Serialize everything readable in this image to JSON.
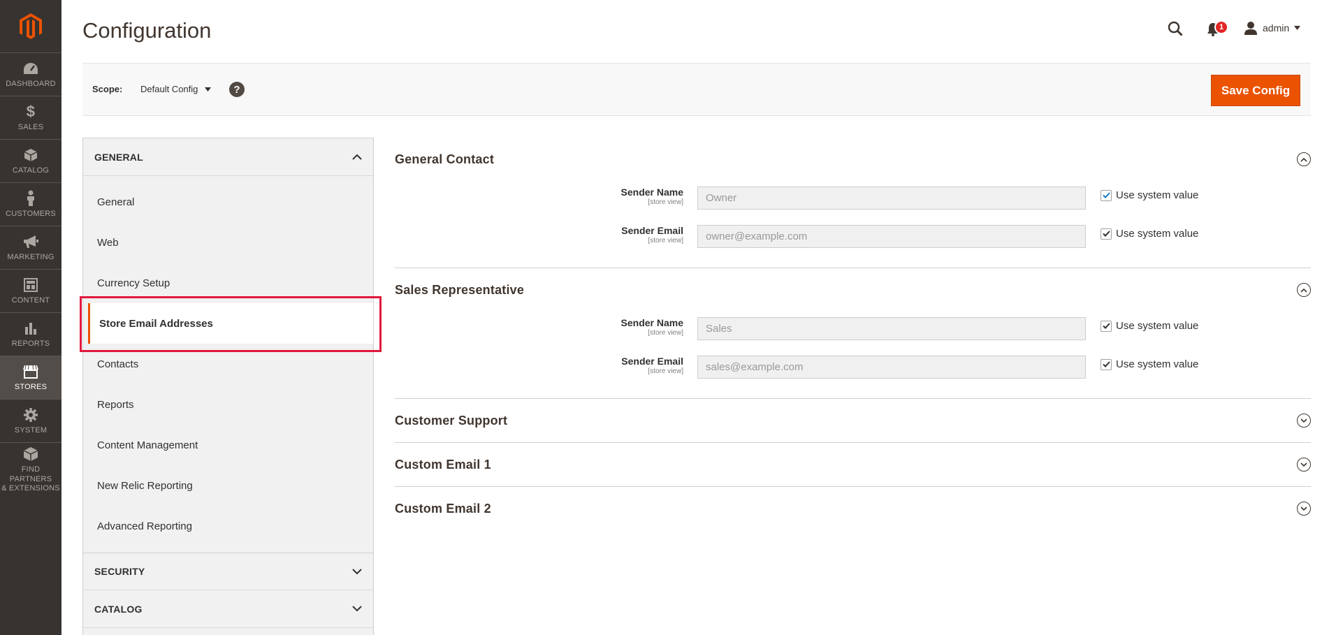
{
  "nav": {
    "items": [
      {
        "label": "DASHBOARD",
        "icon": "dashboard-icon"
      },
      {
        "label": "SALES",
        "icon": "dollar-icon"
      },
      {
        "label": "CATALOG",
        "icon": "box-icon"
      },
      {
        "label": "CUSTOMERS",
        "icon": "person-icon"
      },
      {
        "label": "MARKETING",
        "icon": "megaphone-icon"
      },
      {
        "label": "CONTENT",
        "icon": "layout-icon"
      },
      {
        "label": "REPORTS",
        "icon": "bar-chart-icon"
      },
      {
        "label": "STORES",
        "icon": "storefront-icon"
      },
      {
        "label": "SYSTEM",
        "icon": "gear-icon"
      },
      {
        "label1": "FIND PARTNERS",
        "label2": "& EXTENSIONS",
        "icon": "extensions-icon"
      }
    ]
  },
  "header": {
    "title": "Configuration",
    "notifications_count": "1",
    "user": "admin"
  },
  "scope": {
    "label": "Scope:",
    "value": "Default Config",
    "help": "?",
    "save_label": "Save Config"
  },
  "tabs": {
    "general_heading": "GENERAL",
    "items": [
      "General",
      "Web",
      "Currency Setup",
      "Store Email Addresses",
      "Contacts",
      "Reports",
      "Content Management",
      "New Relic Reporting",
      "Advanced Reporting"
    ],
    "active_index": 3,
    "security_heading": "SECURITY",
    "catalog_heading": "CATALOG"
  },
  "sections": [
    {
      "title": "General Contact",
      "expanded": true,
      "fields": [
        {
          "label": "Sender Name",
          "scope": "[store view]",
          "value": "Owner",
          "checkbox": "Use system value"
        },
        {
          "label": "Sender Email",
          "scope": "[store view]",
          "value": "owner@example.com",
          "checkbox": "Use system value"
        }
      ]
    },
    {
      "title": "Sales Representative",
      "expanded": true,
      "fields": [
        {
          "label": "Sender Name",
          "scope": "[store view]",
          "value": "Sales",
          "checkbox": "Use system value"
        },
        {
          "label": "Sender Email",
          "scope": "[store view]",
          "value": "sales@example.com",
          "checkbox": "Use system value"
        }
      ]
    },
    {
      "title": "Customer Support",
      "expanded": false
    },
    {
      "title": "Custom Email 1",
      "expanded": false
    },
    {
      "title": "Custom Email 2",
      "expanded": false
    }
  ],
  "colors": {
    "accent": "#eb5202",
    "nav_bg": "#373330",
    "highlight": "#e0183d"
  }
}
